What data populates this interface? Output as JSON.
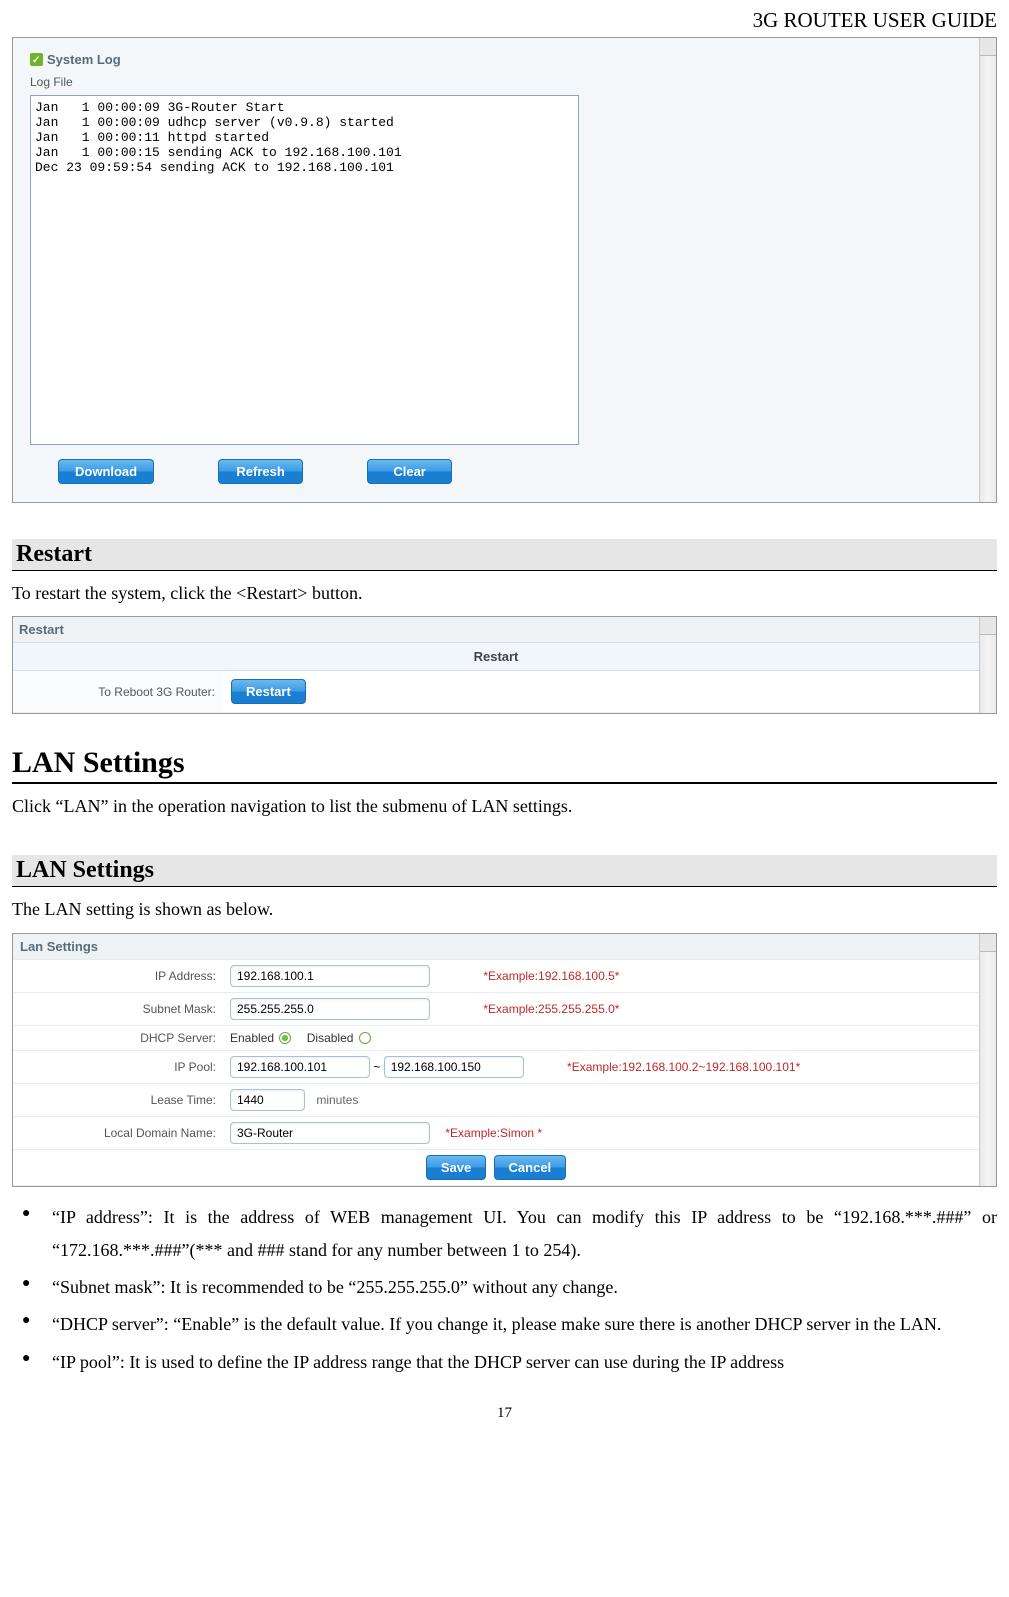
{
  "header": {
    "title": "3G ROUTER USER GUIDE"
  },
  "syslog": {
    "panel_title": "System Log",
    "logfile_label": "Log File",
    "log_content": "Jan   1 00:00:09 3G-Router Start\nJan   1 00:00:09 udhcp server (v0.9.8) started\nJan   1 00:00:11 httpd started\nJan   1 00:00:15 sending ACK to 192.168.100.101\nDec 23 09:59:54 sending ACK to 192.168.100.101",
    "buttons": {
      "download": "Download",
      "refresh": "Refresh",
      "clear": "Clear"
    }
  },
  "restart": {
    "heading": "Restart",
    "intro": "To restart the system, click the <Restart> button.",
    "panel_title": "Restart",
    "sub_title": "Restart",
    "row_label": "To Reboot 3G Router:",
    "button_label": "Restart"
  },
  "lan_section": {
    "h1": "LAN Settings",
    "intro": "Click “LAN” in the operation navigation to list the submenu of LAN settings.",
    "h2": "LAN Settings",
    "intro2": "The LAN setting is shown as below."
  },
  "lan_form": {
    "panel_title": "Lan Settings",
    "rows": {
      "ip": {
        "label": "IP Address:",
        "value": "192.168.100.1",
        "hint": "*Example:192.168.100.5*"
      },
      "mask": {
        "label": "Subnet Mask:",
        "value": "255.255.255.0",
        "hint": "*Example:255.255.255.0*"
      },
      "dhcp": {
        "label": "DHCP Server:",
        "enabled": "Enabled",
        "disabled": "Disabled"
      },
      "pool": {
        "label": "IP Pool:",
        "from": "192.168.100.101",
        "to": "192.168.100.150",
        "tilde": "~",
        "hint": "*Example:192.168.100.2~192.168.100.101*"
      },
      "lease": {
        "label": "Lease Time:",
        "value": "1440",
        "unit": "minutes"
      },
      "domain": {
        "label": "Local Domain Name:",
        "value": "3G-Router",
        "hint": "*Example:Simon *"
      }
    },
    "actions": {
      "save": "Save",
      "cancel": "Cancel"
    }
  },
  "bullets": {
    "b1": "“IP address”: It is the address of WEB management UI. You can modify this IP address to be “192.168.***.###” or “172.168.***.###”(*** and ### stand for any number between 1 to 254).",
    "b2": "“Subnet mask”: It is recommended to be “255.255.255.0” without any change.",
    "b3": "“DHCP server”: “Enable” is the default value. If you change it, please make sure there is another DHCP server in the LAN.",
    "b4": "“IP pool”: It is used to define the IP address range that the DHCP server can use during the IP address"
  },
  "page_number": "17"
}
